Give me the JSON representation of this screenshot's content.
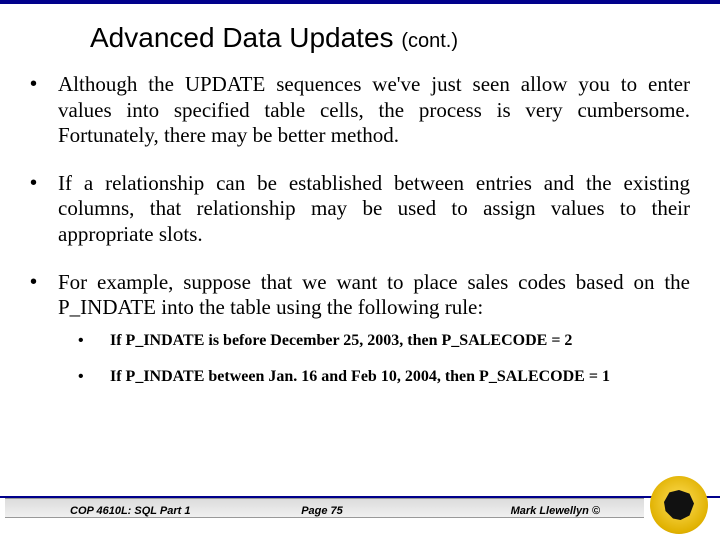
{
  "title_main": "Advanced Data Updates ",
  "title_cont": "(cont.)",
  "bullets": [
    "Although the UPDATE sequences we've just seen allow you to enter values into specified table cells, the process is very cumbersome.  Fortunately, there may be better method.",
    "If a relationship can be established between entries and the existing columns, that relationship may be used to assign values to their appropriate slots.",
    "For example, suppose that we want to place sales codes based on the P_INDATE into the table using the following rule:"
  ],
  "sub_bullets": [
    "If P_INDATE is before December 25, 2003, then P_SALECODE = 2",
    "If P_INDATE  between Jan. 16 and Feb 10, 2004, then P_SALECODE = 1"
  ],
  "footer": {
    "left": "COP 4610L: SQL Part 1",
    "center": "Page 75",
    "right": "Mark Llewellyn ©"
  }
}
